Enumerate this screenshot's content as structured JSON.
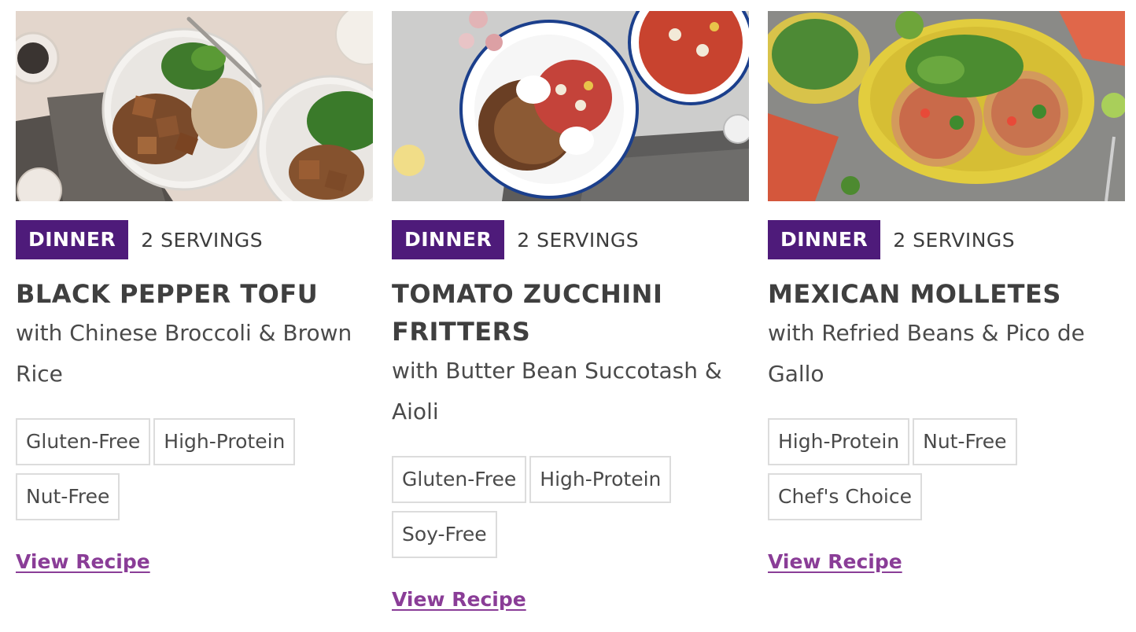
{
  "recipes": [
    {
      "image_alt": "black-pepper-tofu-photo",
      "category": "DINNER",
      "servings": "2 SERVINGS",
      "title": "BLACK PEPPER TOFU",
      "subtitle": "with Chinese Broccoli & Brown Rice",
      "tags": [
        "Gluten-Free",
        "High-Protein",
        "Nut-Free"
      ],
      "link": "View Recipe"
    },
    {
      "image_alt": "tomato-zucchini-fritters-photo",
      "category": "DINNER",
      "servings": "2 SERVINGS",
      "title": "TOMATO ZUCCHINI FRITTERS",
      "subtitle": "with Butter Bean Succotash & Aioli",
      "tags": [
        "Gluten-Free",
        "High-Protein",
        "Soy-Free"
      ],
      "link": "View Recipe"
    },
    {
      "image_alt": "mexican-molletes-photo",
      "category": "DINNER",
      "servings": "2 SERVINGS",
      "title": "MEXICAN MOLLETES",
      "subtitle": "with Refried Beans & Pico de Gallo",
      "tags": [
        "High-Protein",
        "Nut-Free",
        "Chef's Choice"
      ],
      "link": "View Recipe"
    }
  ],
  "colors": {
    "badge_bg": "#4e1b7a",
    "link": "#8a3d97",
    "tag_border": "#dcdcdc",
    "text": "#4a4a4a"
  }
}
